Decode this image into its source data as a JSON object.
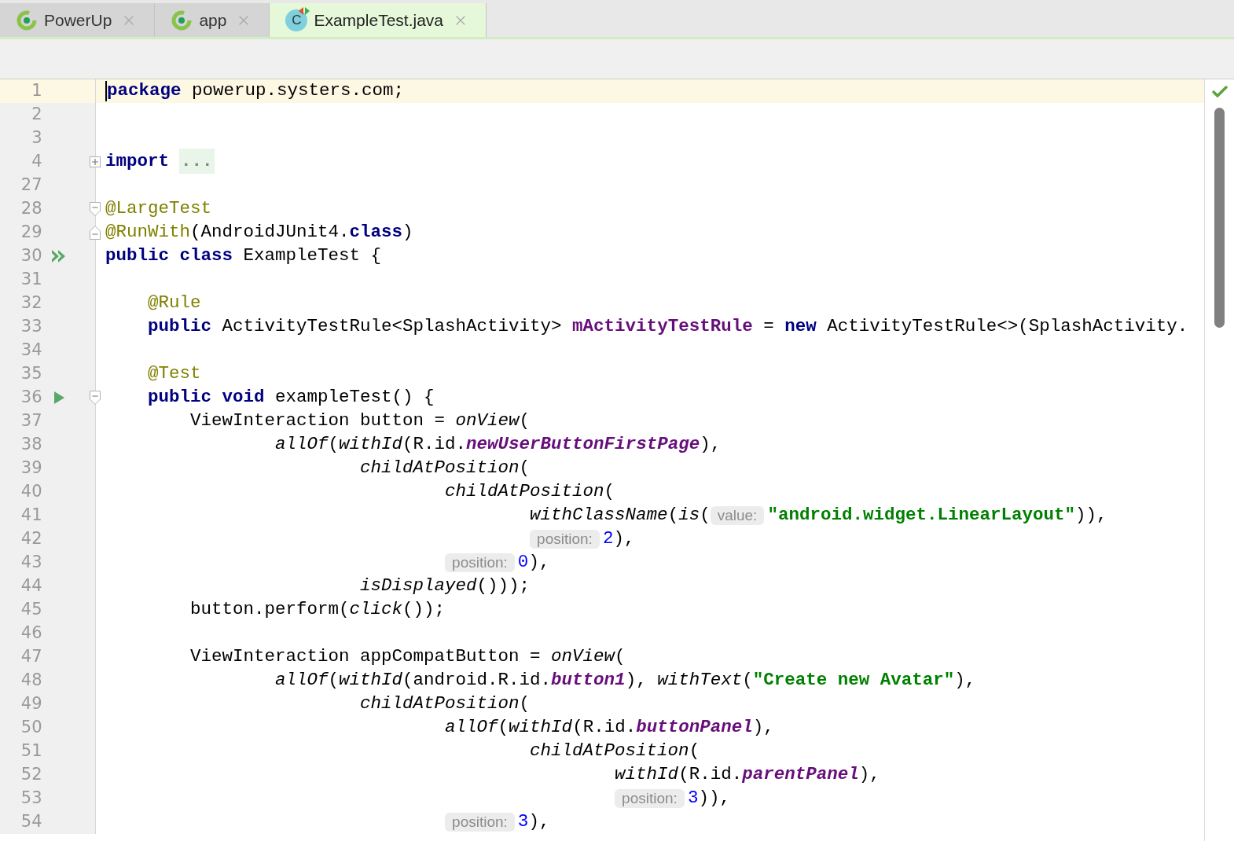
{
  "tabs": [
    {
      "label": "PowerUp",
      "selected": false,
      "kind": "module"
    },
    {
      "label": "app",
      "selected": false,
      "kind": "module"
    },
    {
      "label": "ExampleTest.java",
      "selected": true,
      "kind": "class",
      "icon_text": "C"
    }
  ],
  "editor": {
    "lines": [
      {
        "number": "1",
        "current": true,
        "tokens": [
          {
            "kind": "keyword",
            "text": "package"
          },
          {
            "kind": "plain",
            "text": " powerup.systers.com;"
          }
        ]
      },
      {
        "number": "2",
        "current": false
      },
      {
        "number": "3",
        "current": false
      },
      {
        "number": "4",
        "current": false,
        "fold": {
          "kind": "expand"
        },
        "tokens": [
          {
            "kind": "keyword",
            "text": "import"
          },
          {
            "kind": "folded",
            "text": "..."
          }
        ]
      },
      {
        "number": "27",
        "current": false
      },
      {
        "number": "28",
        "current": false,
        "fold": {
          "kind": "start"
        },
        "tokens": [
          {
            "kind": "annotation",
            "text": "@LargeTest"
          }
        ]
      },
      {
        "number": "29",
        "current": false,
        "fold": {
          "kind": "end"
        },
        "tokens": [
          {
            "kind": "annotation",
            "text": "@RunWith"
          },
          {
            "kind": "plain",
            "text": "(AndroidJUnit4."
          },
          {
            "kind": "keyword",
            "text": "class"
          },
          {
            "kind": "plain",
            "text": ")"
          }
        ]
      },
      {
        "number": "30",
        "current": false,
        "gutter": {
          "kind": "run-all"
        },
        "tokens": [
          {
            "kind": "keyword",
            "text": "public class"
          },
          {
            "kind": "plain",
            "text": " ExampleTest {"
          }
        ]
      },
      {
        "number": "31",
        "current": false
      },
      {
        "number": "32",
        "current": false,
        "tokens": [
          {
            "kind": "annotation",
            "text": "    @Rule"
          }
        ]
      },
      {
        "number": "33",
        "current": false,
        "tokens": [
          {
            "kind": "keyword",
            "text": "    public"
          },
          {
            "kind": "plain",
            "text": " ActivityTestRule<SplashActivity> "
          },
          {
            "kind": "field",
            "text": "mActivityTestRule"
          },
          {
            "kind": "plain",
            "text": " = "
          },
          {
            "kind": "keyword",
            "text": "new"
          },
          {
            "kind": "plain",
            "text": " ActivityTestRule<>(SplashActivity."
          }
        ]
      },
      {
        "number": "34",
        "current": false
      },
      {
        "number": "35",
        "current": false,
        "tokens": [
          {
            "kind": "annotation",
            "text": "    @Test"
          }
        ]
      },
      {
        "number": "36",
        "current": false,
        "gutter": {
          "kind": "run"
        },
        "fold": {
          "kind": "start"
        },
        "tokens": [
          {
            "kind": "keyword",
            "text": "    public void"
          },
          {
            "kind": "plain",
            "text": " exampleTest() {"
          }
        ]
      },
      {
        "number": "37",
        "current": false,
        "tokens": [
          {
            "kind": "plain",
            "text": "        ViewInteraction button = "
          },
          {
            "kind": "method",
            "text": "onView"
          },
          {
            "kind": "plain",
            "text": "("
          }
        ]
      },
      {
        "number": "38",
        "current": false,
        "tokens": [
          {
            "kind": "method",
            "text": "                allOf"
          },
          {
            "kind": "plain",
            "text": "("
          },
          {
            "kind": "method",
            "text": "withId"
          },
          {
            "kind": "plain",
            "text": "(R.id."
          },
          {
            "kind": "static-field",
            "text": "newUserButtonFirstPage"
          },
          {
            "kind": "plain",
            "text": "),"
          }
        ]
      },
      {
        "number": "39",
        "current": false,
        "tokens": [
          {
            "kind": "method",
            "text": "                        childAtPosition"
          },
          {
            "kind": "plain",
            "text": "("
          }
        ]
      },
      {
        "number": "40",
        "current": false,
        "tokens": [
          {
            "kind": "method",
            "text": "                                childAtPosition"
          },
          {
            "kind": "plain",
            "text": "("
          }
        ]
      },
      {
        "number": "41",
        "current": false,
        "tokens": [
          {
            "kind": "method",
            "text": "                                        withClassName"
          },
          {
            "kind": "plain",
            "text": "("
          },
          {
            "kind": "method",
            "text": "is"
          },
          {
            "kind": "plain",
            "text": "("
          },
          {
            "kind": "hint",
            "text": "value:"
          },
          {
            "kind": "string",
            "text": "\"android.widget.LinearLayout\""
          },
          {
            "kind": "plain",
            "text": ")),"
          }
        ]
      },
      {
        "number": "42",
        "current": false,
        "tokens": [
          {
            "kind": "hint",
            "text": "                                        position:"
          },
          {
            "kind": "number",
            "text": "2"
          },
          {
            "kind": "plain",
            "text": "),"
          }
        ]
      },
      {
        "number": "43",
        "current": false,
        "tokens": [
          {
            "kind": "hint",
            "text": "                                position:"
          },
          {
            "kind": "number",
            "text": "0"
          },
          {
            "kind": "plain",
            "text": "),"
          }
        ]
      },
      {
        "number": "44",
        "current": false,
        "tokens": [
          {
            "kind": "method",
            "text": "                        isDisplayed"
          },
          {
            "kind": "plain",
            "text": "()));"
          }
        ]
      },
      {
        "number": "45",
        "current": false,
        "tokens": [
          {
            "kind": "plain",
            "text": "        button.perform("
          },
          {
            "kind": "method",
            "text": "click"
          },
          {
            "kind": "plain",
            "text": "());"
          }
        ]
      },
      {
        "number": "46",
        "current": false
      },
      {
        "number": "47",
        "current": false,
        "tokens": [
          {
            "kind": "plain",
            "text": "        ViewInteraction appCompatButton = "
          },
          {
            "kind": "method",
            "text": "onView"
          },
          {
            "kind": "plain",
            "text": "("
          }
        ]
      },
      {
        "number": "48",
        "current": false,
        "tokens": [
          {
            "kind": "method",
            "text": "                allOf"
          },
          {
            "kind": "plain",
            "text": "("
          },
          {
            "kind": "method",
            "text": "withId"
          },
          {
            "kind": "plain",
            "text": "(android.R.id."
          },
          {
            "kind": "static-field",
            "text": "button1"
          },
          {
            "kind": "plain",
            "text": "), "
          },
          {
            "kind": "method",
            "text": "withText"
          },
          {
            "kind": "plain",
            "text": "("
          },
          {
            "kind": "string",
            "text": "\"Create new Avatar\""
          },
          {
            "kind": "plain",
            "text": "),"
          }
        ]
      },
      {
        "number": "49",
        "current": false,
        "tokens": [
          {
            "kind": "method",
            "text": "                        childAtPosition"
          },
          {
            "kind": "plain",
            "text": "("
          }
        ]
      },
      {
        "number": "50",
        "current": false,
        "tokens": [
          {
            "kind": "method",
            "text": "                                allOf"
          },
          {
            "kind": "plain",
            "text": "("
          },
          {
            "kind": "method",
            "text": "withId"
          },
          {
            "kind": "plain",
            "text": "(R.id."
          },
          {
            "kind": "static-field",
            "text": "buttonPanel"
          },
          {
            "kind": "plain",
            "text": "),"
          }
        ]
      },
      {
        "number": "51",
        "current": false,
        "tokens": [
          {
            "kind": "method",
            "text": "                                        childAtPosition"
          },
          {
            "kind": "plain",
            "text": "("
          }
        ]
      },
      {
        "number": "52",
        "current": false,
        "tokens": [
          {
            "kind": "method",
            "text": "                                                withId"
          },
          {
            "kind": "plain",
            "text": "(R.id."
          },
          {
            "kind": "static-field",
            "text": "parentPanel"
          },
          {
            "kind": "plain",
            "text": "),"
          }
        ]
      },
      {
        "number": "53",
        "current": false,
        "tokens": [
          {
            "kind": "hint",
            "text": "                                                position:"
          },
          {
            "kind": "number",
            "text": "3"
          },
          {
            "kind": "plain",
            "text": ")),"
          }
        ]
      },
      {
        "number": "54",
        "current": false,
        "tokens": [
          {
            "kind": "hint",
            "text": "                                position:"
          },
          {
            "kind": "number",
            "text": "3"
          },
          {
            "kind": "plain",
            "text": "),"
          }
        ]
      }
    ]
  }
}
